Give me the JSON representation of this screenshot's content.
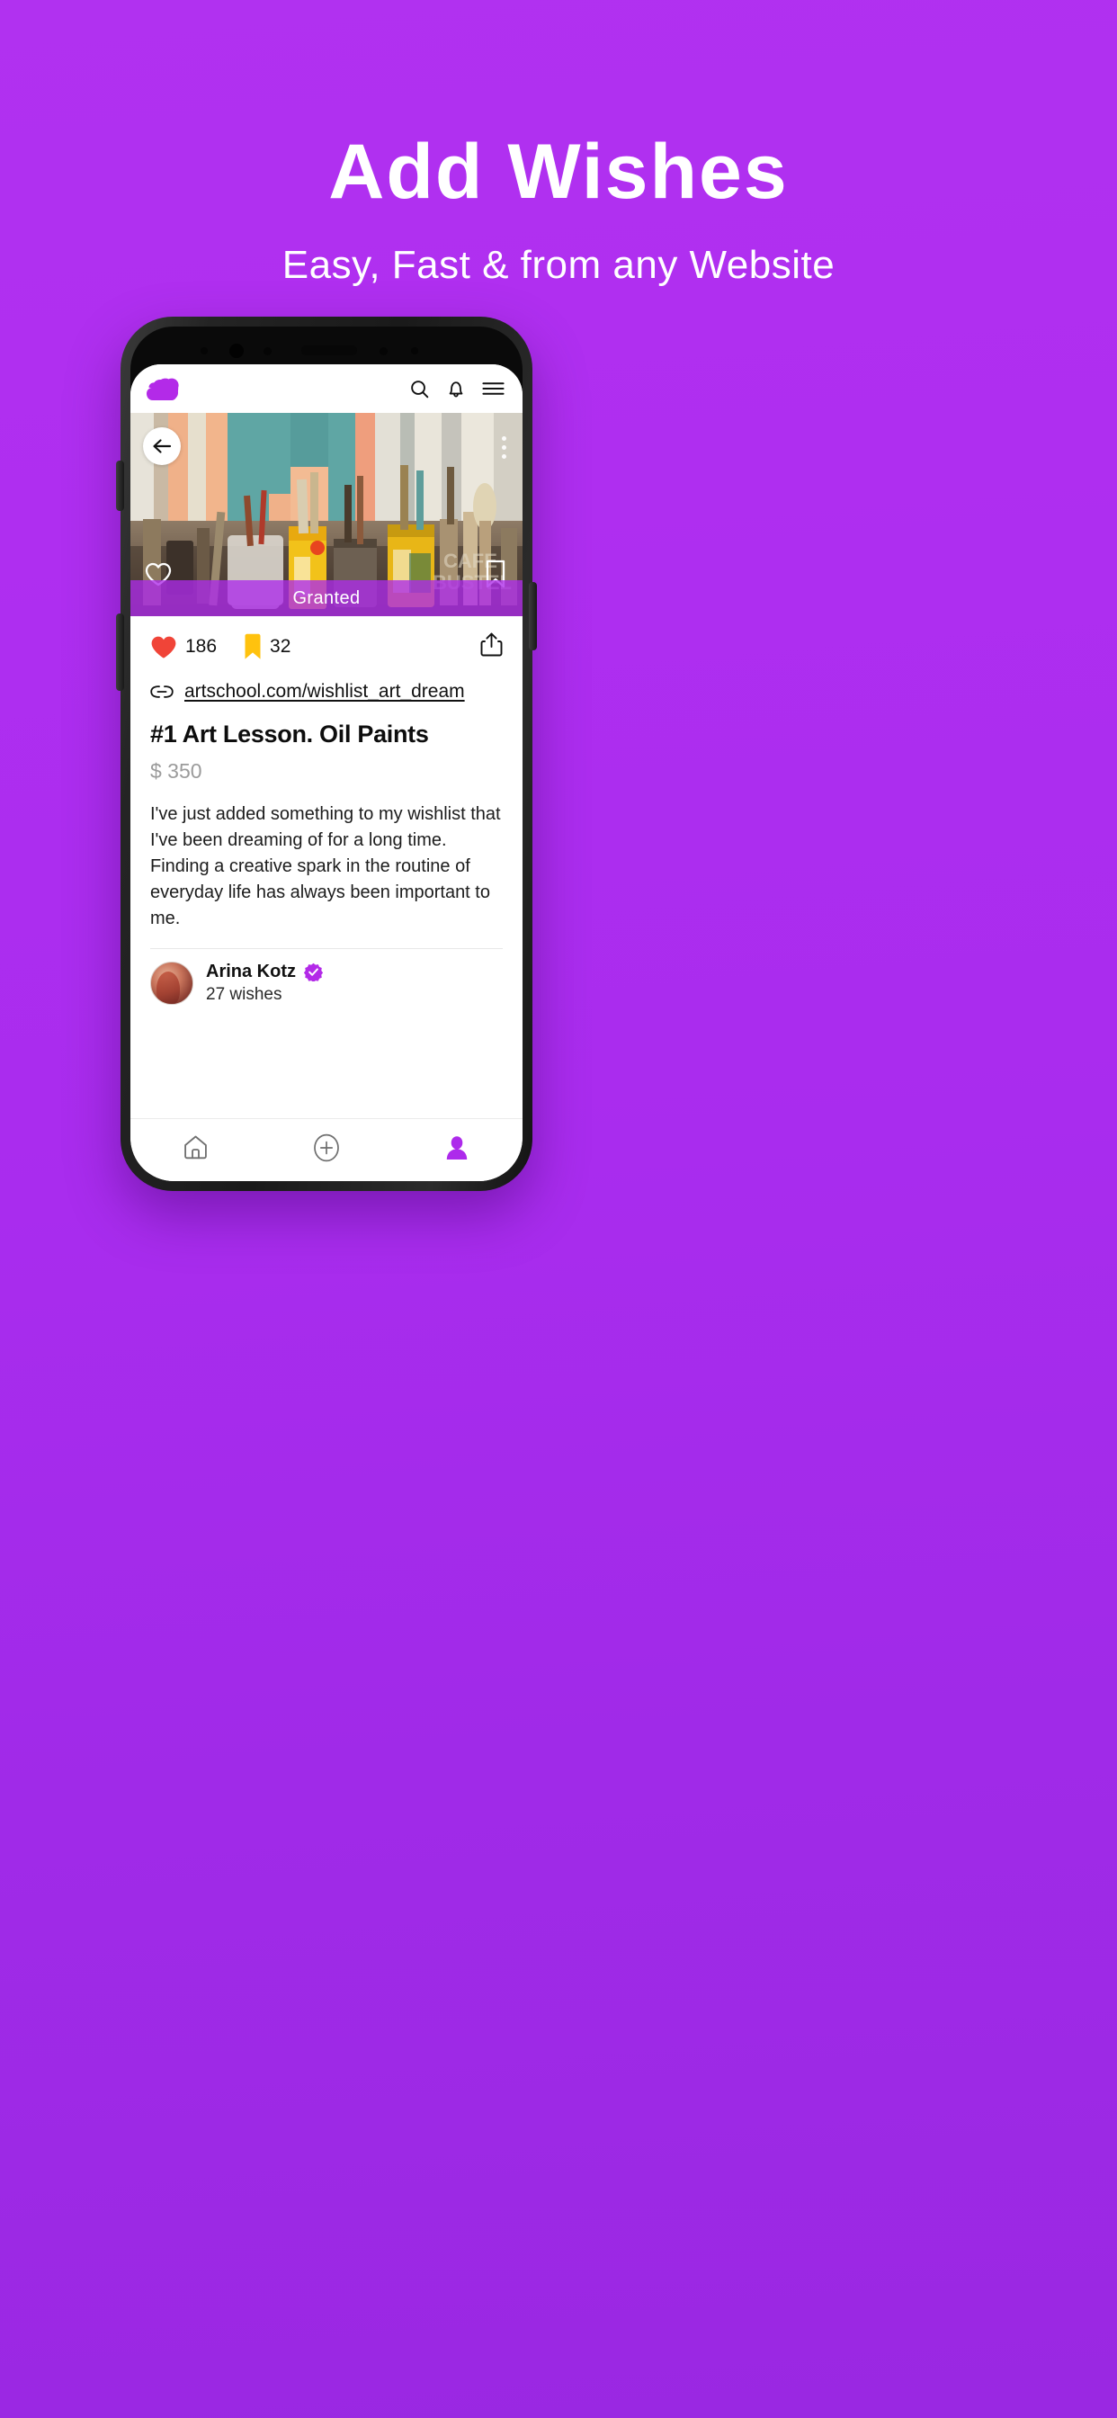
{
  "promo": {
    "title": "Add Wishes",
    "subtitle": "Easy, Fast & from any Website"
  },
  "colors": {
    "background_top": "#b131f0",
    "background_bottom": "#9a28e2",
    "accent_purple": "#ad2aeb",
    "heart_red": "#f04438",
    "bookmark_yellow": "#ffc20e",
    "verified_purple": "#b32ae8",
    "muted_text": "#9b9b9b"
  },
  "app": {
    "header": {
      "logo_name": "wishlist-heart-logo",
      "icons": [
        "search-icon",
        "bell-icon",
        "hamburger-menu-icon"
      ]
    },
    "hero": {
      "back_label": "back-arrow-icon",
      "more_label": "more-options-icon",
      "like_label": "heart-outline-icon",
      "save_label": "bookmark-outline-icon",
      "status_badge": "Granted"
    },
    "stats": {
      "likes": "186",
      "saves": "32",
      "share_label": "share-icon"
    },
    "item": {
      "link_text": "artschool.com/wishlist_art_dream",
      "title": "#1 Art Lesson. Oil Paints",
      "price": "$ 350",
      "description": "I've just added something to my wishlist that I've been dreaming of for a long time. Finding a creative spark in the routine of everyday life has always been important to me."
    },
    "author": {
      "name": "Arina Kotz",
      "wishes": "27 wishes",
      "verified": true
    },
    "nav": {
      "items": [
        {
          "name": "home",
          "active": false
        },
        {
          "name": "add",
          "active": false
        },
        {
          "name": "profile",
          "active": true
        }
      ]
    }
  }
}
